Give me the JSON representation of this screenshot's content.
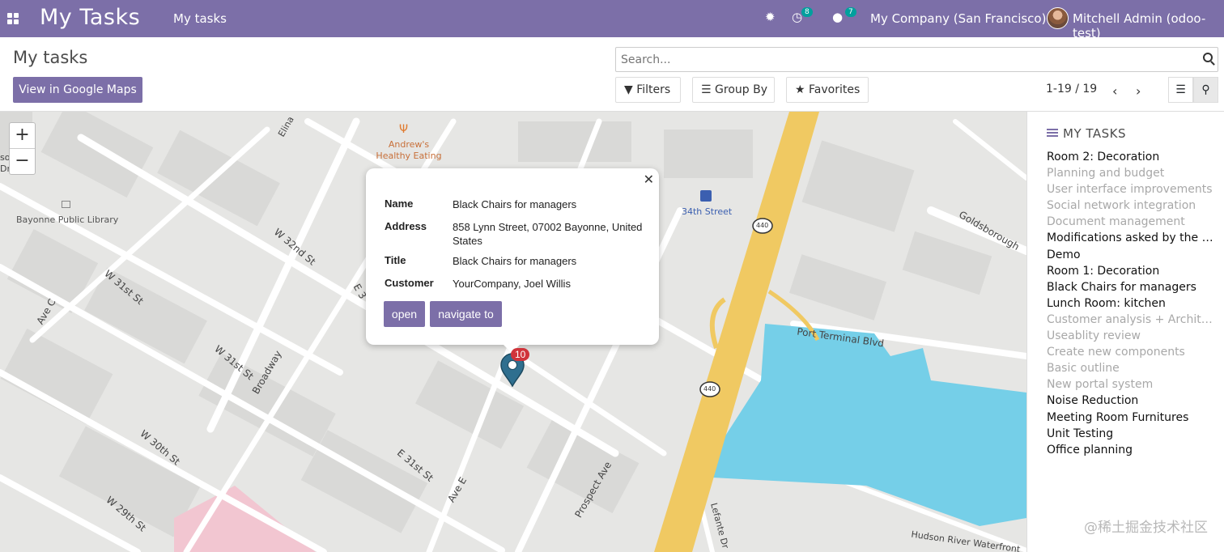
{
  "navbar": {
    "brand": "My Tasks",
    "menu_item": "My tasks",
    "activity_count": "8",
    "message_count": "7",
    "company": "My Company (San Francisco)",
    "user": "Mitchell Admin (odoo-test)"
  },
  "control_panel": {
    "breadcrumb": "My tasks",
    "google_maps_button": "View in Google Maps",
    "search_placeholder": "Search...",
    "filters_label": "Filters",
    "group_by_label": "Group By",
    "favorites_label": "Favorites",
    "pager": "1-19 / 19"
  },
  "map": {
    "labels": {
      "restaurant": "Andrew's\nHealthy Eating",
      "library": "Bayonne Public Library",
      "station": "34th Street",
      "w32": "W 32nd St",
      "w31": "W 31st St",
      "w31b": "W 31st St",
      "w30": "W 30th St",
      "w29": "W 29th St",
      "e31": "E 31st St",
      "e3": "E 3",
      "avec": "Ave C",
      "avee": "Ave E",
      "broadway": "Broadway",
      "prospect": "Prospect Ave",
      "portterminal": "Port Terminal Blvd",
      "goldsborough": "Goldsborough",
      "lefante": "Lefante Dr",
      "hudson": "Hudson River Waterfront",
      "elina": "Elina",
      "so": "so",
      "dr": "Dr",
      "hwy": "440"
    },
    "marker_count": "10"
  },
  "popup": {
    "fields": [
      {
        "key": "Name",
        "value": "Black Chairs for managers"
      },
      {
        "key": "Address",
        "value": "858 Lynn Street, 07002 Bayonne, United States"
      },
      {
        "key": "Title",
        "value": "Black Chairs for managers"
      },
      {
        "key": "Customer",
        "value": "YourCompany, Joel Willis"
      }
    ],
    "open_label": "open",
    "navigate_label": "navigate to"
  },
  "sidebar": {
    "title": "MY TASKS",
    "items": [
      {
        "label": "Room 2: Decoration",
        "located": true
      },
      {
        "label": "Planning and budget",
        "located": false
      },
      {
        "label": "User interface improvements",
        "located": false
      },
      {
        "label": "Social network integration",
        "located": false
      },
      {
        "label": "Document management",
        "located": false
      },
      {
        "label": "Modifications asked by the c…",
        "located": true
      },
      {
        "label": "Demo",
        "located": true
      },
      {
        "label": "Room 1: Decoration",
        "located": true
      },
      {
        "label": "Black Chairs for managers",
        "located": true
      },
      {
        "label": "Lunch Room: kitchen",
        "located": true
      },
      {
        "label": "Customer analysis + Archite…",
        "located": false
      },
      {
        "label": "Useablity review",
        "located": false
      },
      {
        "label": "Create new components",
        "located": false
      },
      {
        "label": "Basic outline",
        "located": false
      },
      {
        "label": "New portal system",
        "located": false
      },
      {
        "label": "Noise Reduction",
        "located": true
      },
      {
        "label": "Meeting Room Furnitures",
        "located": true
      },
      {
        "label": "Unit Testing",
        "located": true
      },
      {
        "label": "Office planning",
        "located": true
      }
    ]
  },
  "watermark": "@稀土掘金技术社区",
  "colors": {
    "brand": "#7c6fa8",
    "highway": "#f0c962",
    "water": "#75cfe8",
    "marker": "#2f6f8f",
    "badge_red": "#d0343b"
  }
}
